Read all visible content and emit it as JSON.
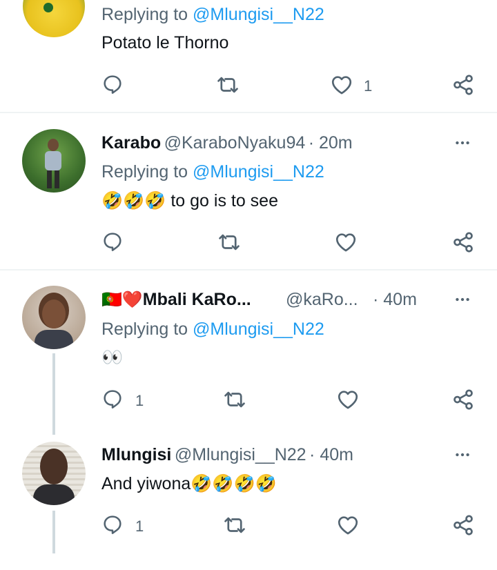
{
  "colors": {
    "accent": "#1d9bf0",
    "muted": "#536471",
    "text": "#0f1419",
    "divider": "#eff3f4"
  },
  "tweets": [
    {
      "reply_prefix": "Replying to",
      "reply_handle": "@Mlungisi__N22",
      "text": "Potato le Thorno",
      "reply_count": "",
      "like_count": "1"
    },
    {
      "name": "Karabo",
      "handle": "@KaraboNyaku94",
      "time": "· 20m",
      "reply_prefix": "Replying to",
      "reply_handle": "@Mlungisi__N22",
      "text_emoji": "🤣🤣🤣",
      "text": " to go is to see",
      "reply_count": "",
      "like_count": ""
    },
    {
      "name_emoji": "🇵🇹❤️",
      "name": "Mbali KaRo...",
      "handle": "@kaRo...",
      "time": "· 40m",
      "reply_prefix": "Replying to",
      "reply_handle": "@Mlungisi__N22",
      "text": "👀",
      "reply_count": "1",
      "like_count": ""
    },
    {
      "name": "Mlungisi",
      "handle": "@Mlungisi__N22",
      "time": "· 40m",
      "text": "And yiwona",
      "text_emoji": "🤣🤣🤣🤣",
      "reply_count": "1",
      "like_count": ""
    }
  ]
}
